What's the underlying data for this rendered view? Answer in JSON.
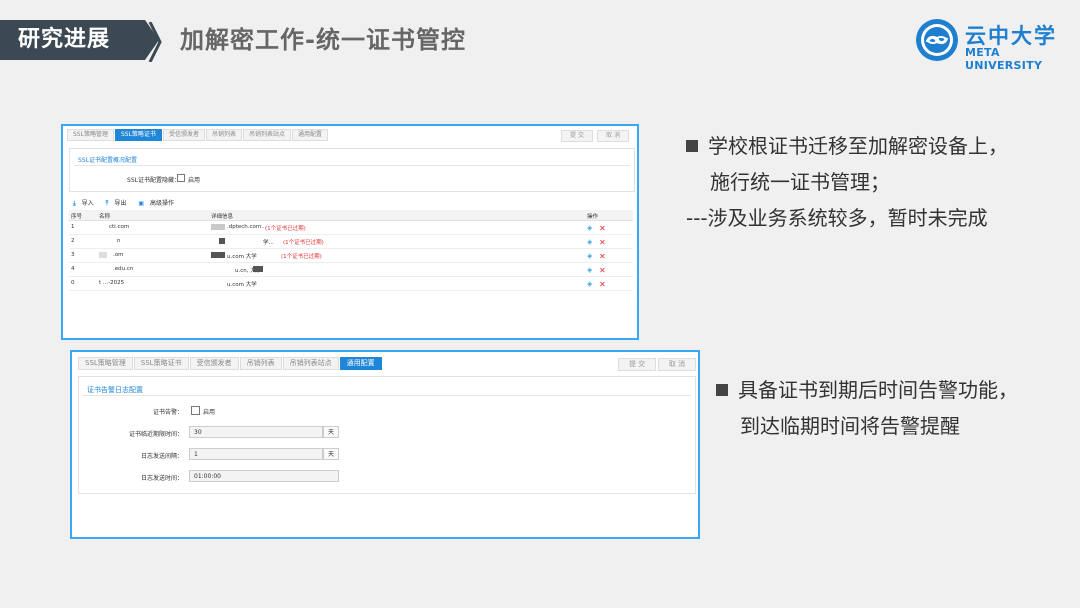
{
  "header": {
    "section": "研究进展",
    "title": "加解密工作-统一证书管控",
    "logo_cn": "云中大学",
    "logo_en": "META UNIVERSITY"
  },
  "shot1": {
    "tabs": [
      "SSL策略管理",
      "SSL策略证书",
      "受信颁发者",
      "吊销列表",
      "吊销列表站点",
      "通用配置"
    ],
    "active_tab": 1,
    "btn_submit": "提 交",
    "btn_cancel": "取 消",
    "panel_title": "SSL证书配置概况配置",
    "field_label": "SSL证书配置隐藏：",
    "checkbox_label": "启用",
    "toolbar": [
      "导入",
      "导出",
      "高级操作"
    ],
    "columns": [
      "序号",
      "名称",
      "详细信息",
      "操作"
    ],
    "rows": [
      {
        "id": "1",
        "name": "cti.com",
        "detail": ".dptech.com...",
        "warning": "(1个证书已过期)"
      },
      {
        "id": "2",
        "name": "n",
        "detail": "学...",
        "warning": "(1个证书已过期)"
      },
      {
        "id": "3",
        "name": ".om",
        "detail": "u.com 大学",
        "warning": "(1个证书已过期)"
      },
      {
        "id": "4",
        "name": ".edu.cn",
        "detail": "u.cn, 大学",
        "warning": ""
      },
      {
        "id": "0",
        "name": "t ...-2025",
        "detail": "u.com 大学",
        "warning": ""
      }
    ]
  },
  "shot2": {
    "tabs": [
      "SSL策略管理",
      "SSL策略证书",
      "受信颁发者",
      "吊销列表",
      "吊销列表站点",
      "通用配置"
    ],
    "active_tab": 5,
    "btn_submit": "提 交",
    "btn_cancel": "取 消",
    "panel_title": "证书告警日志配置",
    "fields": [
      {
        "label": "证书告警：",
        "type": "checkbox",
        "checkbox_label": "启用"
      },
      {
        "label": "证书临近期限时间：",
        "type": "input",
        "value": "30",
        "unit": "天"
      },
      {
        "label": "日志发送间隔：",
        "type": "input",
        "value": "1",
        "unit": "天"
      },
      {
        "label": "日志发送时间：",
        "type": "input",
        "value": "01:00:00",
        "unit": ""
      }
    ]
  },
  "bullets_top": {
    "line1": "学校根证书迁移至加解密设备上，",
    "line2": "施行统一证书管理；",
    "line3": "---涉及业务系统较多，暂时未完成"
  },
  "bullets_bottom": {
    "line1": "具备证书到期后时间告警功能，",
    "line2": "到达临期时间将告警提醒"
  },
  "colors": {
    "accent": "#1f86d8",
    "frame": "#3aa7f2",
    "dark": "#3c4852",
    "warning": "#e03030"
  }
}
